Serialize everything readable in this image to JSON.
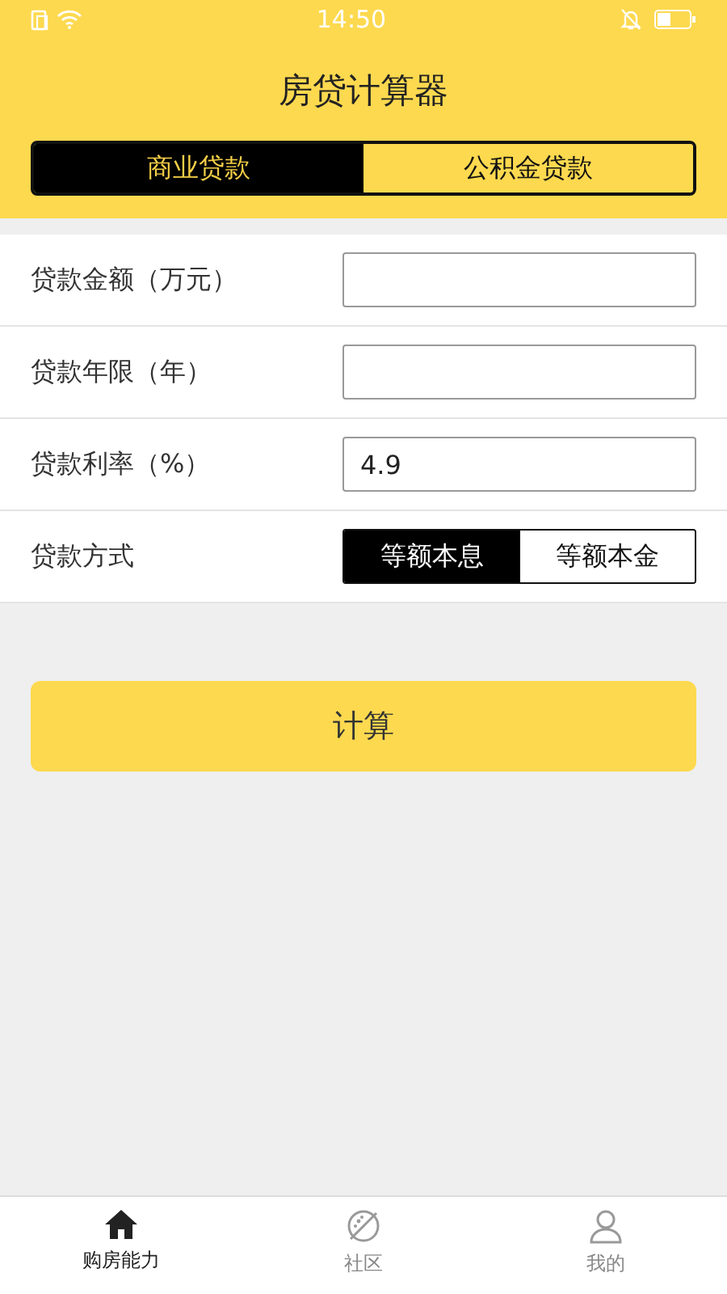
{
  "status_bar": {
    "time": "14:50"
  },
  "title": "房贷计算器",
  "tabs": [
    {
      "label": "商业贷款",
      "selected": true
    },
    {
      "label": "公积金贷款",
      "selected": false
    }
  ],
  "form": [
    {
      "kind": "input",
      "label": "贷款金额（万元）"
    },
    {
      "kind": "input",
      "label": "贷款年限（年）"
    },
    {
      "kind": "input",
      "label": "贷款利率（%）",
      "value": "4.9"
    },
    {
      "kind": "segment",
      "label": "贷款方式",
      "options": [
        {
          "label": "等额本息",
          "selected": true
        },
        {
          "label": "等额本金",
          "selected": false
        }
      ]
    }
  ],
  "button": "计算",
  "nav": [
    {
      "kind": "home",
      "label": "购房能力",
      "selected": true
    },
    {
      "kind": "community",
      "label": "社区",
      "selected": false
    },
    {
      "kind": "profile",
      "label": "我的",
      "selected": false
    }
  ]
}
